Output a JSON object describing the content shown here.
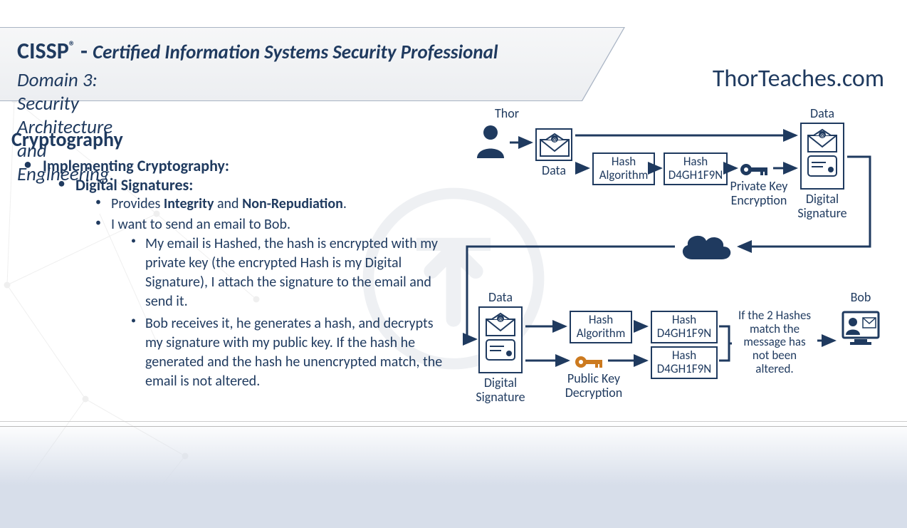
{
  "header": {
    "title_main": "CISSP",
    "title_tm": "®",
    "title_dash": " - ",
    "title_sub": "Certified Information Systems Security Professional",
    "domain_line": "Domain 3: Security Architecture and Engineering.",
    "site": "ThorTeaches.com"
  },
  "content": {
    "heading": "Cryptography",
    "l1": "Implementing Cryptography:",
    "l2": "Digital Signatures:",
    "l3a_pre": "Provides ",
    "l3a_b1": "Integrity",
    "l3a_mid": " and ",
    "l3a_b2": "Non-Repudiation",
    "l3a_post": ".",
    "l3b": "I want to send an email to Bob.",
    "l4a": "My email is Hashed, the hash is encrypted with my private key (the encrypted Hash is my Digital Signature), I attach the signature to the email and send it.",
    "l4b": "Bob receives it, he generates a hash, and decrypts my signature with my public key. If the hash he generated and the hash he unencrypted match, the email is not altered."
  },
  "diagram": {
    "thor": "Thor",
    "bob": "Bob",
    "data": "Data",
    "hash_alg": "Hash\nAlgorithm",
    "hash_val": "Hash\nD4GH1F9N",
    "priv_key": "Private Key\nEncryption",
    "dig_sig": "Digital\nSignature",
    "pub_key": "Public Key\nDecryption",
    "match_text": "If the 2 Hashes\nmatch the\nmessage has\nnot been\naltered."
  }
}
